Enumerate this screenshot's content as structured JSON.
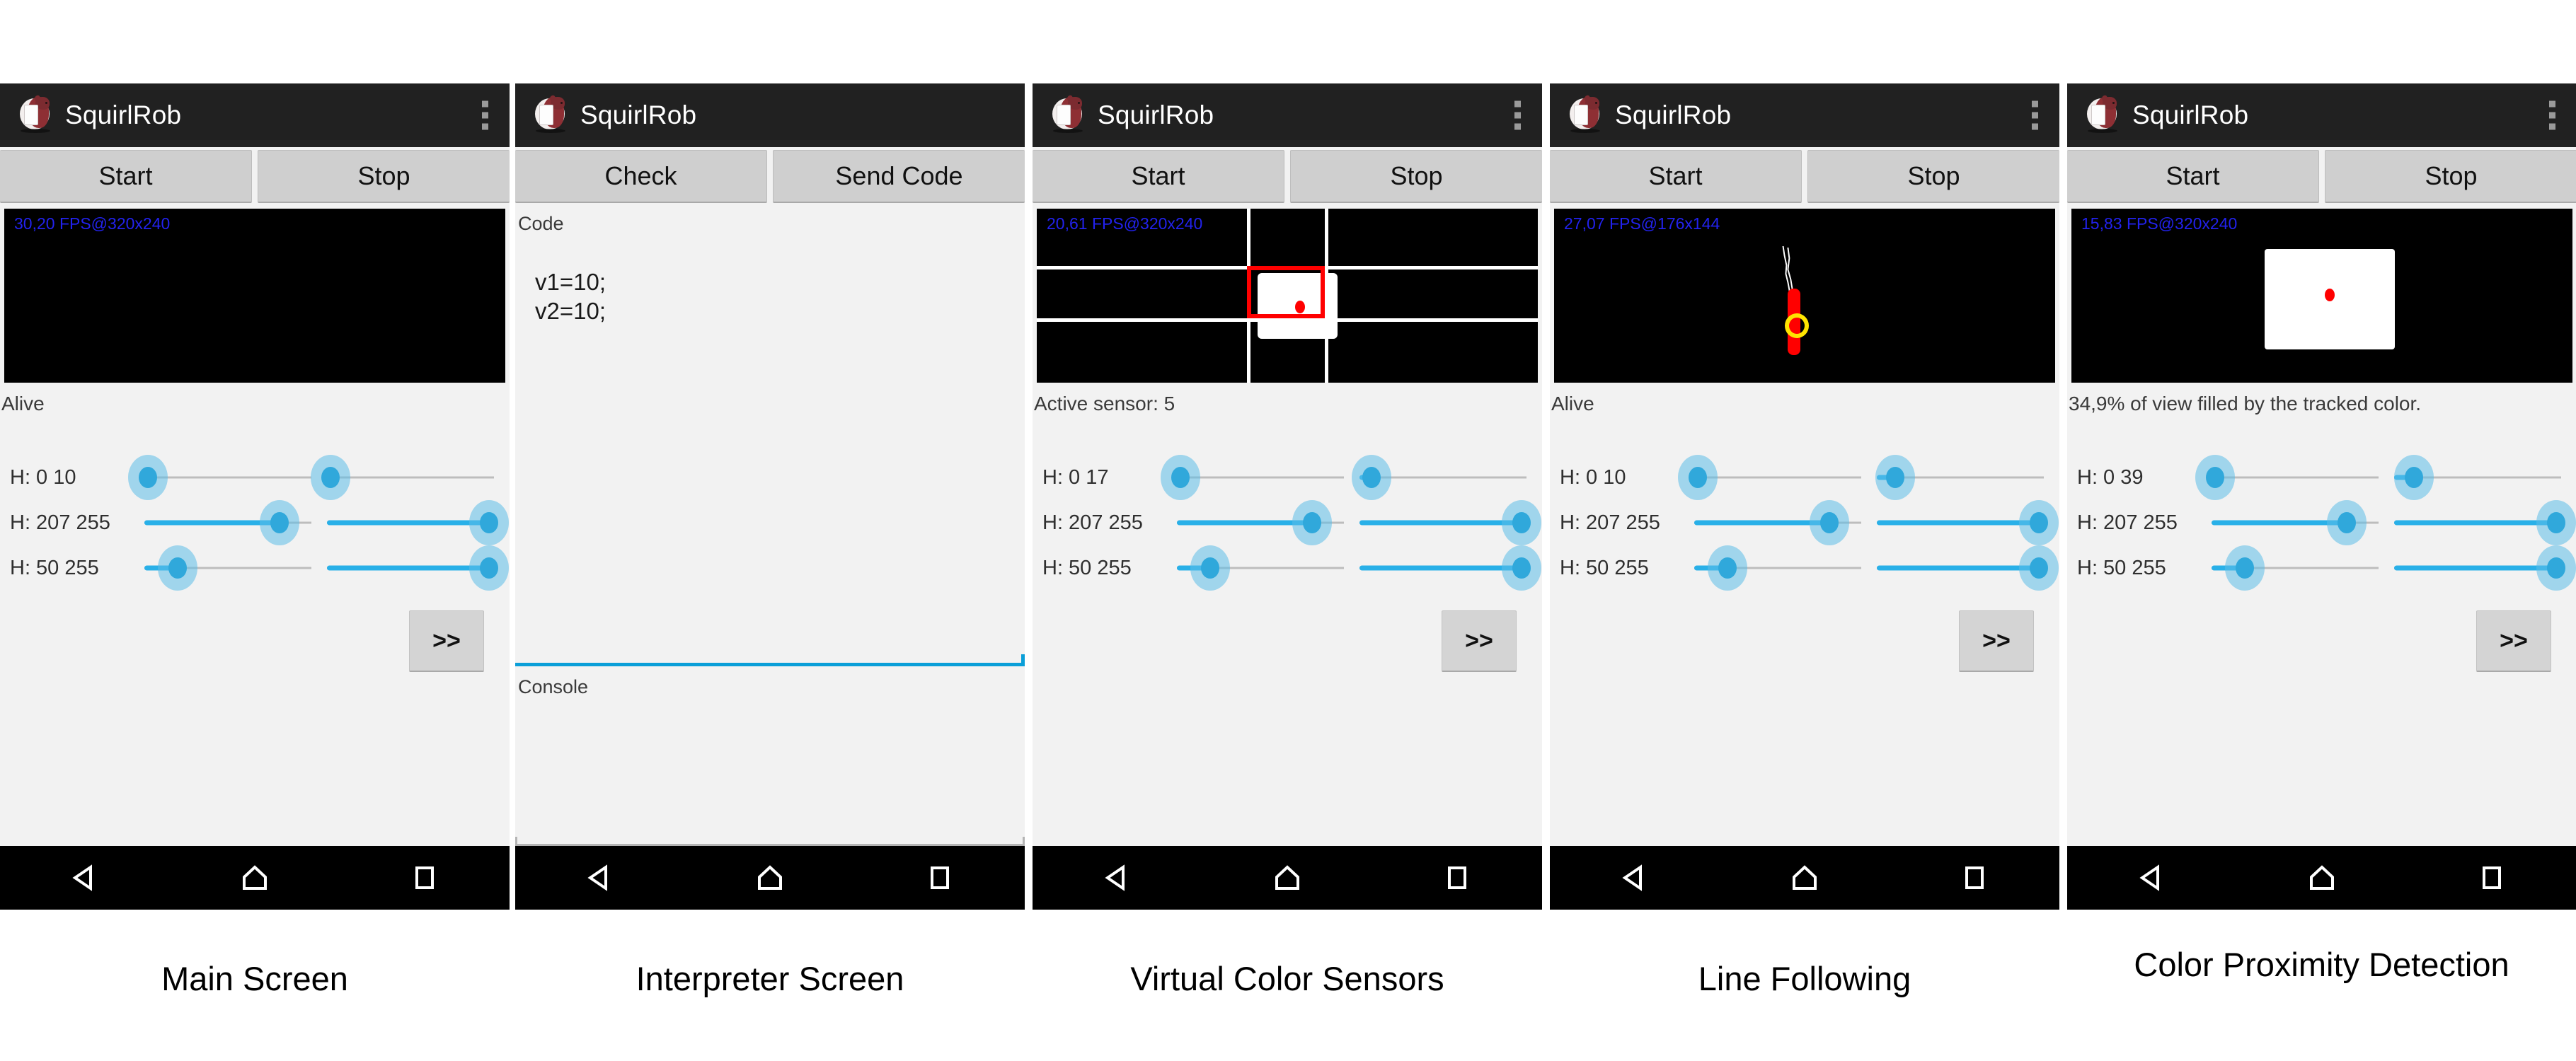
{
  "app": {
    "title": "SquirlRob",
    "logo_icon": "squirrel-robot-logo",
    "overflow_icon": "overflow-menu-icon"
  },
  "navbar": {
    "back_icon": "back-triangle-icon",
    "home_icon": "home-pentagon-icon",
    "recents_icon": "recents-square-icon"
  },
  "captions": [
    "Main Screen",
    "Interpreter Screen",
    "Virtual Color Sensors",
    "Line Following",
    "Color Proximity Detection"
  ],
  "panels": [
    {
      "id": "main-screen",
      "buttons": [
        "Start",
        "Stop"
      ],
      "fps_overlay": "30,20 FPS@320x240",
      "status": "Alive",
      "next_label": ">>",
      "sliders": [
        {
          "label": "H: 0 10",
          "left_pct": 2,
          "right_pct": 2
        },
        {
          "label": "H: 207 255",
          "left_pct": 81,
          "right_pct": 97
        },
        {
          "label": "H: 50 255",
          "left_pct": 20,
          "right_pct": 97
        }
      ]
    },
    {
      "id": "interpreter-screen",
      "buttons": [
        "Check",
        "Send Code"
      ],
      "code_label": "Code",
      "code_value": "v1=10;\nv2=10;",
      "console_label": "Console",
      "console_value": ""
    },
    {
      "id": "virtual-color-sensors",
      "buttons": [
        "Start",
        "Stop"
      ],
      "fps_overlay": "20,61 FPS@320x240",
      "status": "Active sensor: 5",
      "next_label": ">>",
      "sliders": [
        {
          "label": "H: 0 17",
          "left_pct": 2,
          "right_pct": 7
        },
        {
          "label": "H: 207 255",
          "left_pct": 81,
          "right_pct": 97
        },
        {
          "label": "H: 50 255",
          "left_pct": 20,
          "right_pct": 97
        }
      ]
    },
    {
      "id": "line-following",
      "buttons": [
        "Start",
        "Stop"
      ],
      "fps_overlay": "27,07 FPS@176x144",
      "status": "Alive",
      "next_label": ">>",
      "sliders": [
        {
          "label": "H: 0 10",
          "left_pct": 2,
          "right_pct": 11
        },
        {
          "label": "H: 207 255",
          "left_pct": 81,
          "right_pct": 97
        },
        {
          "label": "H: 50 255",
          "left_pct": 20,
          "right_pct": 97
        }
      ]
    },
    {
      "id": "color-proximity-detection",
      "buttons": [
        "Start",
        "Stop"
      ],
      "fps_overlay": "15,83 FPS@320x240",
      "status": "34,9% of view filled by the tracked color.",
      "next_label": ">>",
      "sliders": [
        {
          "label": "H: 0 39",
          "left_pct": 2,
          "right_pct": 12
        },
        {
          "label": "H: 207 255",
          "left_pct": 81,
          "right_pct": 97
        },
        {
          "label": "H: 50 255",
          "left_pct": 20,
          "right_pct": 97
        }
      ]
    }
  ],
  "colors": {
    "appbar": "#212121",
    "slider_accent": "#29b0e8",
    "fps_text": "#2222ee",
    "marker_red": "#ff0000",
    "marker_yellow": "#ffe400",
    "panel_bg": "#f2f2f2"
  }
}
